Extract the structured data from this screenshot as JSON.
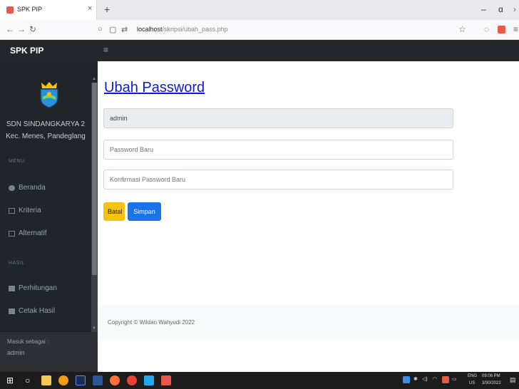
{
  "browser": {
    "tab_title": "SPK PIP",
    "tab_close": "×",
    "new_tab": "+",
    "url_host": "localhost",
    "url_path": "/skripsi/ubah_pass.php",
    "minimize": "–",
    "maximize": "ɑ"
  },
  "app": {
    "brand": "SPK PIP",
    "menu_toggle": "≡"
  },
  "sidebar": {
    "school_name": "SDN SINDANGKARYA 2",
    "school_address": "Kec. Menes, Pandeglang",
    "section_menu": "MENU",
    "menu_items": [
      {
        "label": "Beranda",
        "icon": "home-icon"
      },
      {
        "label": "Kriteria",
        "icon": "table-icon"
      },
      {
        "label": "Alternatif",
        "icon": "table-icon"
      }
    ],
    "section_hasil": "HASIL",
    "hasil_items": [
      {
        "label": "Perhitungan",
        "icon": "chart-icon"
      },
      {
        "label": "Cetak Hasil",
        "icon": "chart-icon"
      }
    ],
    "login_label": "Masuk sebagai :",
    "login_user": "admin"
  },
  "main": {
    "page_title": "Ubah Password",
    "username_value": "admin",
    "new_password_placeholder": "Password Baru",
    "confirm_password_placeholder": "Konfirmasi Password Baru",
    "cancel_label": "Batal",
    "save_label": "Simpan",
    "copyright": "Copyright © Wildan Wahyudi 2022"
  },
  "taskbar": {
    "lang_top": "ENG",
    "lang_bottom": "US",
    "time": "09:06 PM",
    "date": "3/30/2022"
  },
  "colors": {
    "sidebar_bg": "#212529",
    "header_bg": "#23272b",
    "title_link": "#0d1bd6",
    "btn_warning": "#f5c211",
    "btn_primary": "#1a73e8"
  }
}
